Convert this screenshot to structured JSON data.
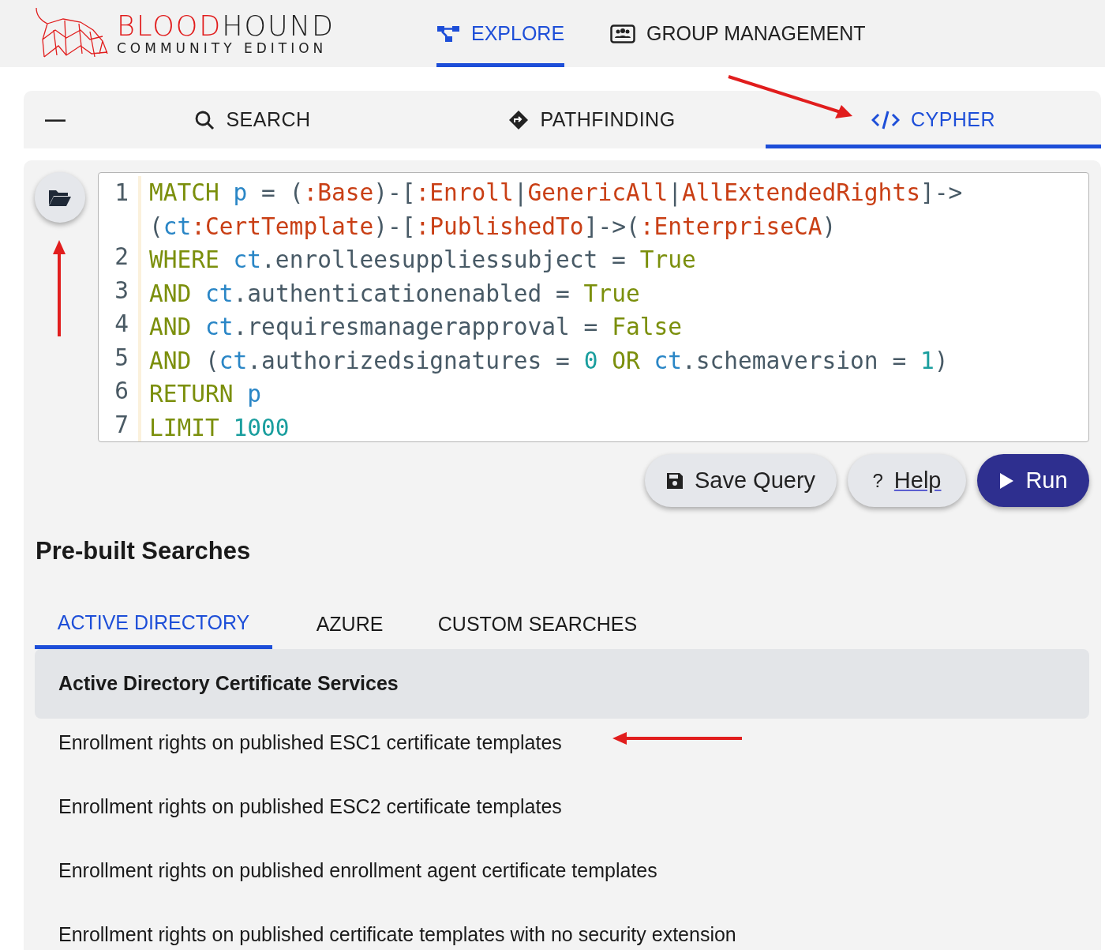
{
  "header": {
    "logo": {
      "word_red": "BLOOD",
      "word_dark": "HOUND",
      "subtitle": "COMMUNITY EDITION"
    },
    "nav": [
      {
        "label": "EXPLORE",
        "selected": true
      },
      {
        "label": "GROUP MANAGEMENT",
        "selected": false
      }
    ]
  },
  "search_tabs": {
    "collapse": "—",
    "tabs": [
      {
        "label": "SEARCH",
        "selected": false
      },
      {
        "label": "PATHFINDING",
        "selected": false
      },
      {
        "label": "CYPHER",
        "selected": true
      }
    ]
  },
  "editor": {
    "lines": [
      {
        "number": "1",
        "visual_lines": [
          {
            "tokens": [
              {
                "kind": "keyword",
                "text": "MATCH"
              },
              {
                "kind": "var",
                "text": " p"
              },
              {
                "kind": "plain",
                "text": " = ("
              },
              {
                "kind": "label",
                "text": ":Base"
              },
              {
                "kind": "plain",
                "text": ")-["
              },
              {
                "kind": "label",
                "text": ":Enroll"
              },
              {
                "kind": "plain",
                "text": "|"
              },
              {
                "kind": "label",
                "text": "GenericAll"
              },
              {
                "kind": "plain",
                "text": "|"
              },
              {
                "kind": "label",
                "text": "AllExtendedRights"
              },
              {
                "kind": "plain",
                "text": "]->"
              }
            ]
          },
          {
            "tokens": [
              {
                "kind": "plain",
                "text": "("
              },
              {
                "kind": "var",
                "text": "ct"
              },
              {
                "kind": "label",
                "text": ":CertTemplate"
              },
              {
                "kind": "plain",
                "text": ")-["
              },
              {
                "kind": "label",
                "text": ":PublishedTo"
              },
              {
                "kind": "plain",
                "text": "]->("
              },
              {
                "kind": "label",
                "text": ":EnterpriseCA"
              },
              {
                "kind": "plain",
                "text": ")"
              }
            ]
          }
        ]
      },
      {
        "number": "2",
        "visual_lines": [
          {
            "tokens": [
              {
                "kind": "keyword",
                "text": "WHERE"
              },
              {
                "kind": "var",
                "text": " ct"
              },
              {
                "kind": "plain",
                "text": ".enrolleesuppliessubject = "
              },
              {
                "kind": "keyword",
                "text": "True"
              }
            ]
          }
        ]
      },
      {
        "number": "3",
        "visual_lines": [
          {
            "tokens": [
              {
                "kind": "keyword",
                "text": "AND"
              },
              {
                "kind": "var",
                "text": " ct"
              },
              {
                "kind": "plain",
                "text": ".authenticationenabled = "
              },
              {
                "kind": "keyword",
                "text": "True"
              }
            ]
          }
        ]
      },
      {
        "number": "4",
        "visual_lines": [
          {
            "tokens": [
              {
                "kind": "keyword",
                "text": "AND"
              },
              {
                "kind": "var",
                "text": " ct"
              },
              {
                "kind": "plain",
                "text": ".requiresmanagerapproval = "
              },
              {
                "kind": "keyword",
                "text": "False"
              }
            ]
          }
        ]
      },
      {
        "number": "5",
        "visual_lines": [
          {
            "tokens": [
              {
                "kind": "keyword",
                "text": "AND"
              },
              {
                "kind": "plain",
                "text": " ("
              },
              {
                "kind": "var",
                "text": "ct"
              },
              {
                "kind": "plain",
                "text": ".authorizedsignatures = "
              },
              {
                "kind": "number",
                "text": "0"
              },
              {
                "kind": "keyword",
                "text": " OR"
              },
              {
                "kind": "var",
                "text": " ct"
              },
              {
                "kind": "plain",
                "text": ".schemaversion = "
              },
              {
                "kind": "number",
                "text": "1"
              },
              {
                "kind": "plain",
                "text": ")"
              }
            ]
          }
        ]
      },
      {
        "number": "6",
        "visual_lines": [
          {
            "tokens": [
              {
                "kind": "keyword",
                "text": "RETURN"
              },
              {
                "kind": "var",
                "text": " p"
              }
            ]
          }
        ]
      },
      {
        "number": "7",
        "visual_lines": [
          {
            "tokens": [
              {
                "kind": "keyword",
                "text": "LIMIT"
              },
              {
                "kind": "number",
                "text": " 1000"
              }
            ]
          }
        ]
      }
    ],
    "buttons": [
      {
        "label": "Save Query",
        "kind": "save"
      },
      {
        "label": "Help",
        "icon_text": "?",
        "kind": "help"
      },
      {
        "label": "Run",
        "kind": "run"
      }
    ]
  },
  "prebuilt": {
    "title": "Pre-built Searches",
    "tabs": [
      {
        "label": "ACTIVE DIRECTORY",
        "selected": true
      },
      {
        "label": "AZURE",
        "selected": false
      },
      {
        "label": "CUSTOM SEARCHES",
        "selected": false
      }
    ],
    "section": "Active Directory Certificate Services",
    "items": [
      "Enrollment rights on published ESC1 certificate templates",
      "Enrollment rights on published ESC2 certificate templates",
      "Enrollment rights on published enrollment agent certificate templates",
      "Enrollment rights on published certificate templates with no security extension"
    ]
  }
}
